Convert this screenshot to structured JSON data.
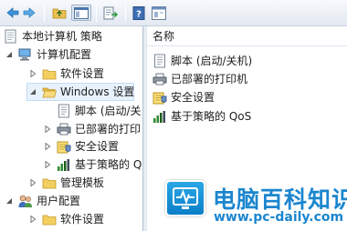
{
  "tree": {
    "root": {
      "label": "本地计算机 策略",
      "icon": "computer-policy-icon"
    },
    "computer_config": {
      "label": "计算机配置",
      "icon": "computer-icon"
    },
    "software_settings": {
      "label": "软件设置",
      "icon": "folder-icon"
    },
    "windows_settings": {
      "label": "Windows 设置",
      "icon": "folder-open-icon"
    },
    "scripts": {
      "label": "脚本 (启动/关",
      "icon": "script-icon"
    },
    "deployed_printers": {
      "label": "已部署的打印",
      "icon": "printer-icon"
    },
    "security_settings": {
      "label": "安全设置",
      "icon": "security-icon"
    },
    "qos": {
      "label": "基于策略的 Q",
      "icon": "bar-chart-icon"
    },
    "admin_templates": {
      "label": "管理模板",
      "icon": "folder-icon"
    },
    "user_config": {
      "label": "用户配置",
      "icon": "users-icon"
    },
    "user_software_settings": {
      "label": "软件设置",
      "icon": "folder-icon"
    }
  },
  "list": {
    "column_header": "名称",
    "items": [
      {
        "label": "脚本 (启动/关机)",
        "icon": "script-icon"
      },
      {
        "label": "已部署的打印机",
        "icon": "printer-icon"
      },
      {
        "label": "安全设置",
        "icon": "security-icon"
      },
      {
        "label": "基于策略的 QoS",
        "icon": "bar-chart-icon"
      }
    ]
  },
  "watermark": {
    "title": "电脑百科知识",
    "url": "www.pc-daily.com"
  },
  "colors": {
    "selection": "#e8f2fd",
    "watermark": "#1b86cf",
    "folder": "#f2c94c"
  }
}
